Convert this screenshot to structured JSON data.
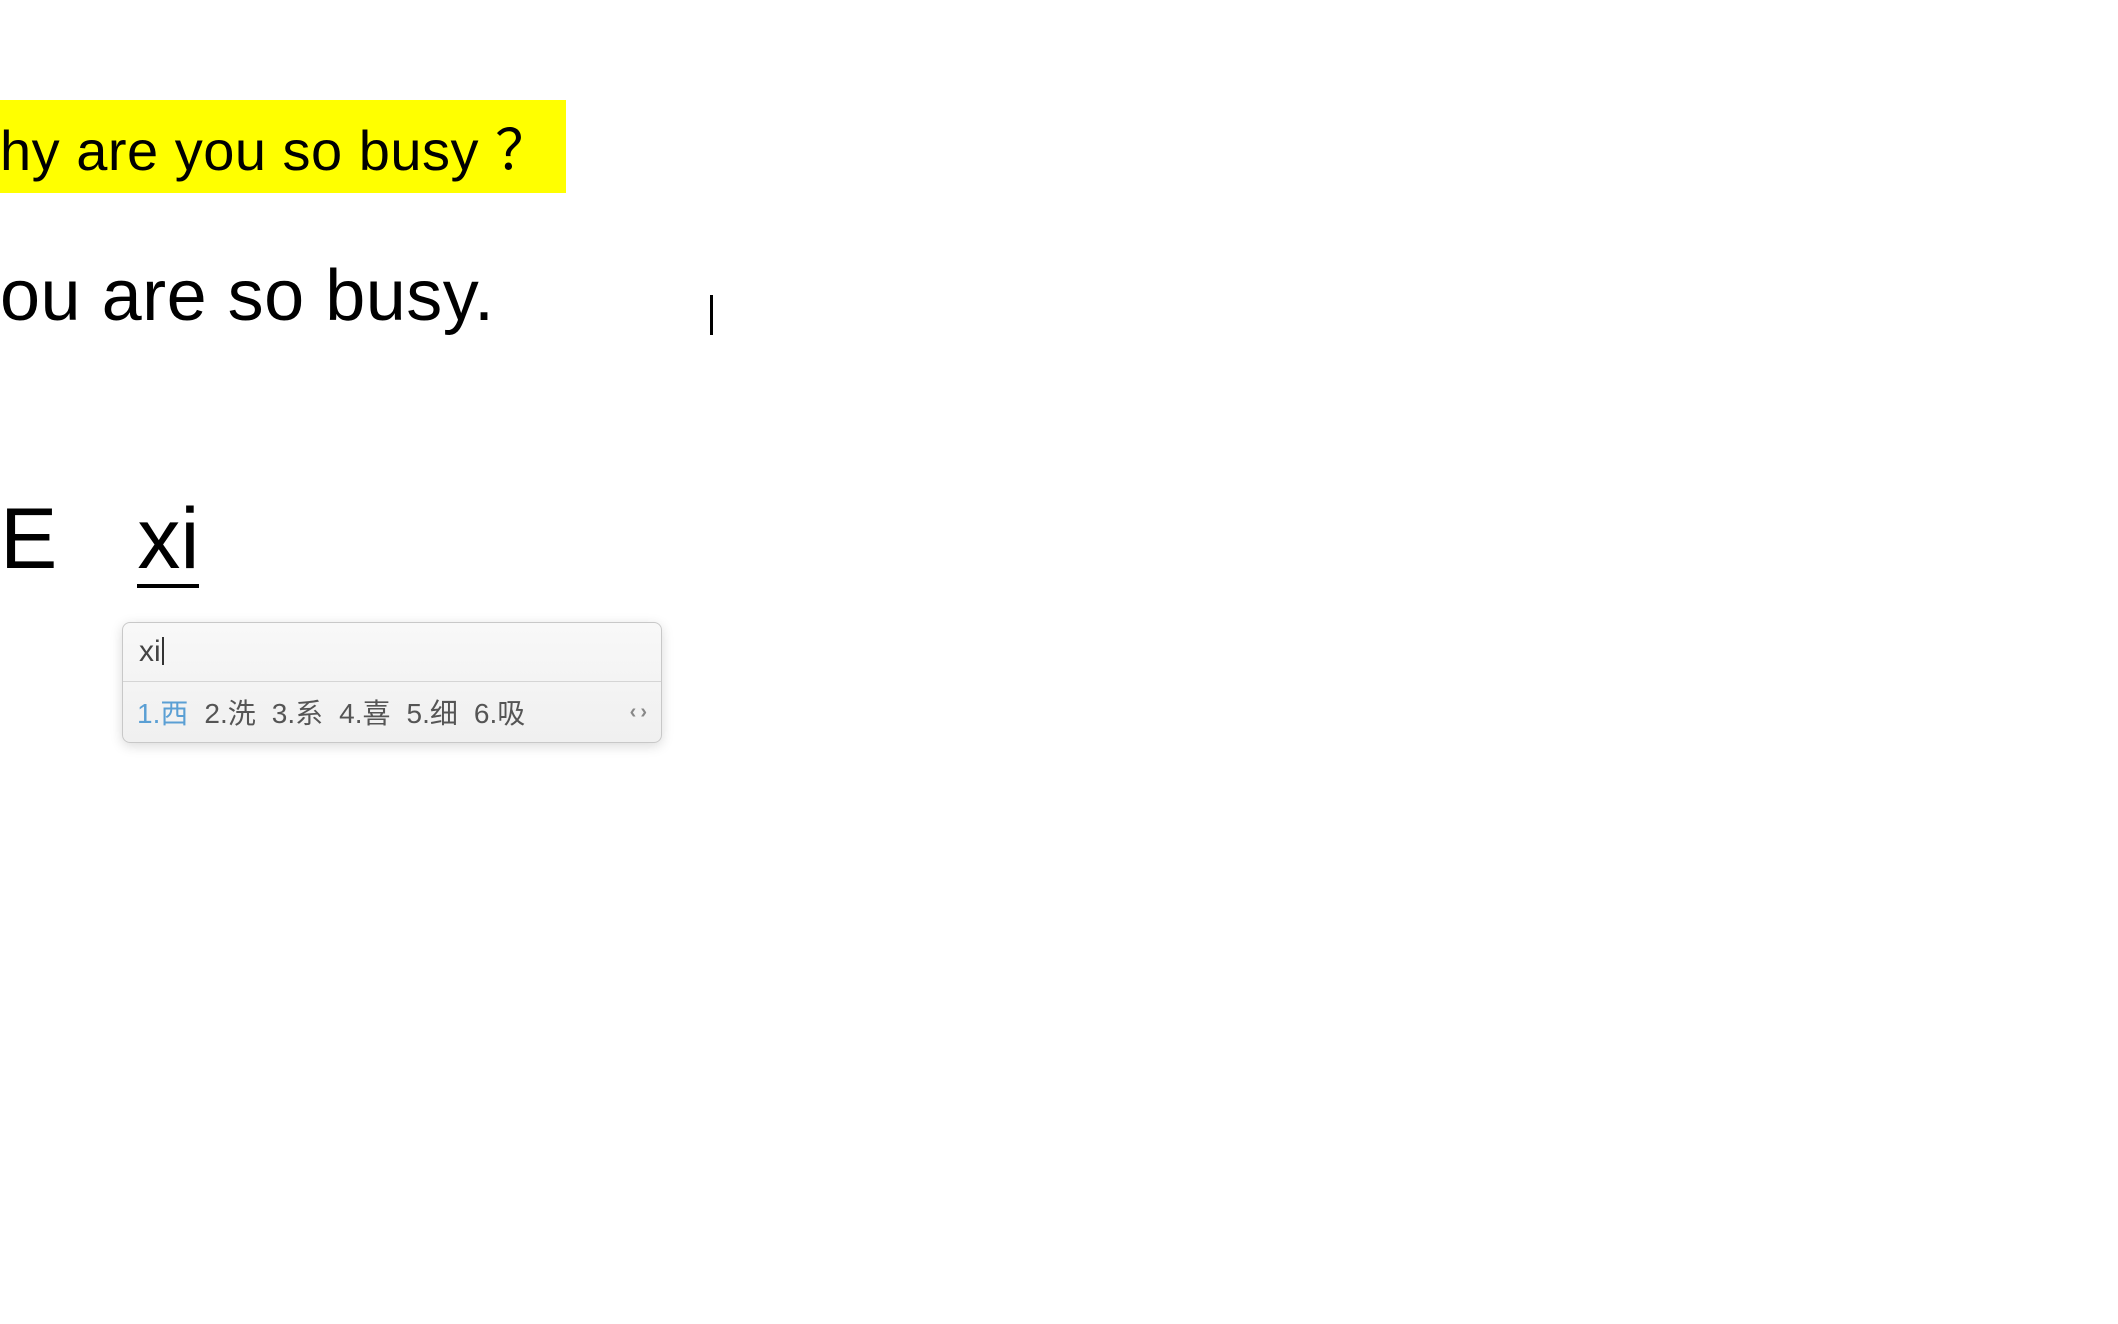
{
  "lines": {
    "highlighted": "hy are you so busy ？",
    "plain": "ou are so busy."
  },
  "composition": {
    "prefix": "E",
    "typing": "xi"
  },
  "ime": {
    "input": "xi",
    "candidates": [
      {
        "index": "1",
        "char": "西",
        "selected": true
      },
      {
        "index": "2",
        "char": "洗",
        "selected": false
      },
      {
        "index": "3",
        "char": "系",
        "selected": false
      },
      {
        "index": "4",
        "char": "喜",
        "selected": false
      },
      {
        "index": "5",
        "char": "细",
        "selected": false
      },
      {
        "index": "6",
        "char": "吸",
        "selected": false
      }
    ]
  }
}
